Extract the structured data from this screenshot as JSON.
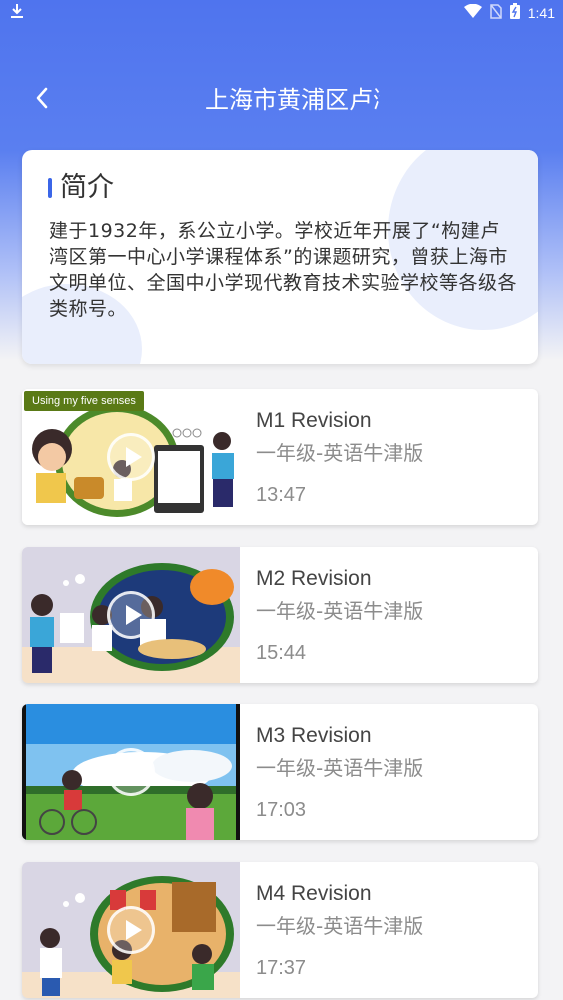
{
  "status": {
    "time": "1:41",
    "icons": [
      "download-icon",
      "wifi-icon",
      "no-sim-icon",
      "battery-icon"
    ]
  },
  "nav": {
    "title": "上海市黄浦区卢湾",
    "back_icon": "chevron-left-icon"
  },
  "intro": {
    "title": "简介",
    "text": "建于1932年，系公立小学。学校近年开展了“构建卢湾区第一中心小学课程体系”的课题研究，曾获上海市文明单位、全国中小学现代教育技术实验学校等各级各类称号。"
  },
  "videos": [
    {
      "title": "M1 Revision",
      "subtitle": "一年级-英语牛津版",
      "duration": "13:47",
      "tag": "Using my five senses"
    },
    {
      "title": "M2 Revision",
      "subtitle": "一年级-英语牛津版",
      "duration": "15:44"
    },
    {
      "title": "M3 Revision",
      "subtitle": "一年级-英语牛津版",
      "duration": "17:03"
    },
    {
      "title": "M4 Revision",
      "subtitle": "一年级-英语牛津版",
      "duration": "17:37"
    }
  ],
  "colors": {
    "header_blue": "#4f74ee",
    "accent": "#3b66e8"
  }
}
